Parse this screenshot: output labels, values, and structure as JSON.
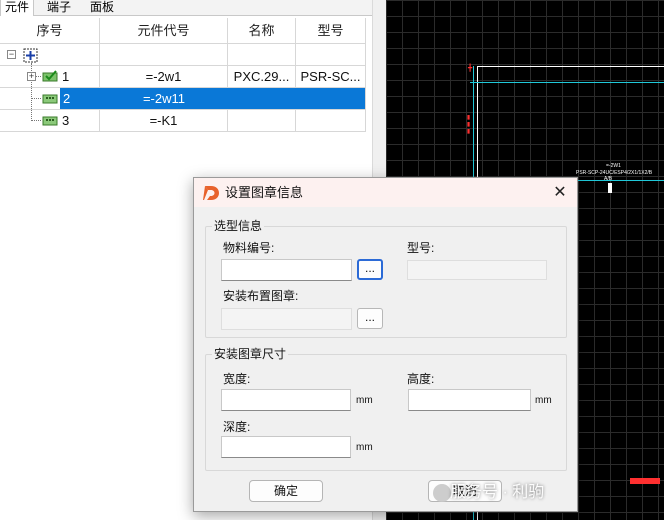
{
  "tabs": [
    "元件",
    "端子",
    "面板"
  ],
  "table": {
    "columns": [
      "序号",
      "元件代号",
      "名称",
      "型号"
    ],
    "rows": [
      {
        "index": "1",
        "code": "=-2w1",
        "name": "PXC.29...",
        "model": "PSR-SC..."
      },
      {
        "index": "2",
        "code": "=-2w11",
        "name": "",
        "model": ""
      },
      {
        "index": "3",
        "code": "=-K1",
        "name": "",
        "model": ""
      }
    ],
    "selected_row": 2
  },
  "dialog": {
    "title": "设置图章信息",
    "close_glyph": "✕",
    "selection_group": "选型信息",
    "material_number_label": "物料编号:",
    "material_number_value": "",
    "model_label": "型号:",
    "model_value": "",
    "install_layout_label": "安装布置图章:",
    "install_layout_value": "",
    "browse_label": "...",
    "size_group": "安装图章尺寸",
    "width_label": "宽度:",
    "height_label": "高度:",
    "depth_label": "深度:",
    "unit": "mm",
    "width_value": "",
    "height_value": "",
    "depth_value": "",
    "ok_label": "确定",
    "cancel_label": "取消"
  },
  "watermark": "服务号 · 利驹",
  "colors": {
    "selection": "#0a78d7",
    "cad_background": "#000000",
    "cad_accent_cyan": "#20c8d8",
    "cad_accent_red": "#ff3030",
    "dialog_title_bg": "#fdf1f0",
    "logo": "#e8622c"
  }
}
